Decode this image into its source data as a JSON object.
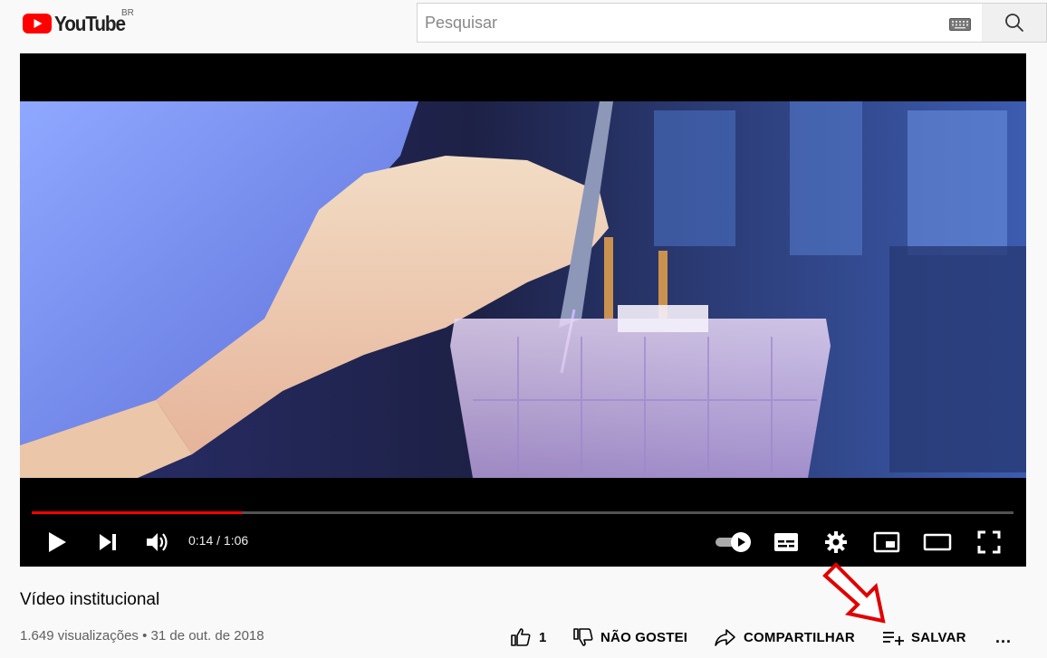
{
  "masthead": {
    "logo_text": "YouTube",
    "country_code": "BR",
    "search": {
      "placeholder": "Pesquisar",
      "value": ""
    }
  },
  "player": {
    "progress_fraction": 0.214,
    "time_label": "0:14 / 1:06",
    "accent_color": "#ff0000"
  },
  "video": {
    "title": "Vídeo institucional",
    "meta": "1.649 visualizações • 31 de out. de 2018",
    "likes_label": "1",
    "dislike_label": "NÃO GOSTEI",
    "share_label": "COMPARTILHAR",
    "save_label": "SALVAR",
    "more_label": "..."
  },
  "icons": [
    "youtube-logo-icon",
    "keyboard-icon",
    "search-icon",
    "play-icon",
    "next-icon",
    "volume-icon",
    "autoplay-toggle-icon",
    "subtitles-icon",
    "settings-gear-icon",
    "miniplayer-icon",
    "theater-mode-icon",
    "fullscreen-icon",
    "thumb-up-icon",
    "thumb-down-icon",
    "share-arrow-icon",
    "add-to-playlist-icon",
    "more-icon",
    "red-arrow-annotation-icon"
  ]
}
